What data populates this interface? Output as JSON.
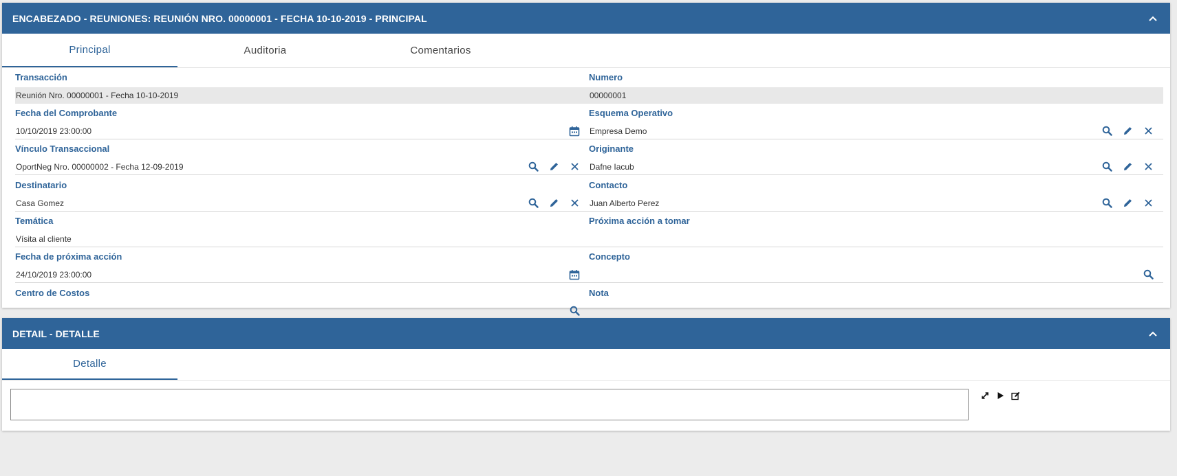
{
  "header_panel": {
    "title": "ENCABEZADO - REUNIONES: REUNIÓN NRO. 00000001 - FECHA 10-10-2019 - PRINCIPAL",
    "tabs": [
      {
        "label": "Principal",
        "active": true
      },
      {
        "label": "Auditoria",
        "active": false
      },
      {
        "label": "Comentarios",
        "active": false
      }
    ],
    "fields": {
      "transaccion": {
        "label": "Transacción",
        "value": "Reunión Nro.  00000001 - Fecha 10-10-2019"
      },
      "numero": {
        "label": "Numero",
        "value": "00000001"
      },
      "fecha_comprobante": {
        "label": "Fecha del Comprobante",
        "value": "10/10/2019 23:00:00"
      },
      "esquema_operativo": {
        "label": "Esquema Operativo",
        "value": "Empresa Demo"
      },
      "vinculo_transaccional": {
        "label": "Vínculo Transaccional",
        "value": "OportNeg Nro.  00000002 - Fecha 12-09-2019"
      },
      "originante": {
        "label": "Originante",
        "value": "Dafne Iacub"
      },
      "destinatario": {
        "label": "Destinatario",
        "value": "Casa Gomez"
      },
      "contacto": {
        "label": "Contacto",
        "value": "Juan Alberto Perez"
      },
      "tematica": {
        "label": "Temática",
        "value": "Vísita al cliente"
      },
      "proxima_accion": {
        "label": "Próxima acción a tomar",
        "value": ""
      },
      "fecha_proxima_accion": {
        "label": "Fecha de próxima acción",
        "value": "24/10/2019 23:00:00"
      },
      "concepto": {
        "label": "Concepto",
        "value": ""
      },
      "centro_costos": {
        "label": "Centro de Costos",
        "value": ""
      },
      "nota": {
        "label": "Nota",
        "value": ""
      }
    }
  },
  "detail_panel": {
    "title": "DETAIL - DETALLE",
    "tabs": [
      {
        "label": "Detalle",
        "active": true
      }
    ]
  },
  "colors": {
    "primary": "#2f6499",
    "readonly_bg": "#e8e8e8"
  },
  "icons": {
    "collapse": "chevron-up-icon",
    "search": "search-icon",
    "edit": "pencil-icon",
    "clear": "close-icon",
    "calendar": "calendar-icon",
    "expand": "expand-icon",
    "play": "play-icon",
    "edit_grid": "edit-square-icon"
  }
}
